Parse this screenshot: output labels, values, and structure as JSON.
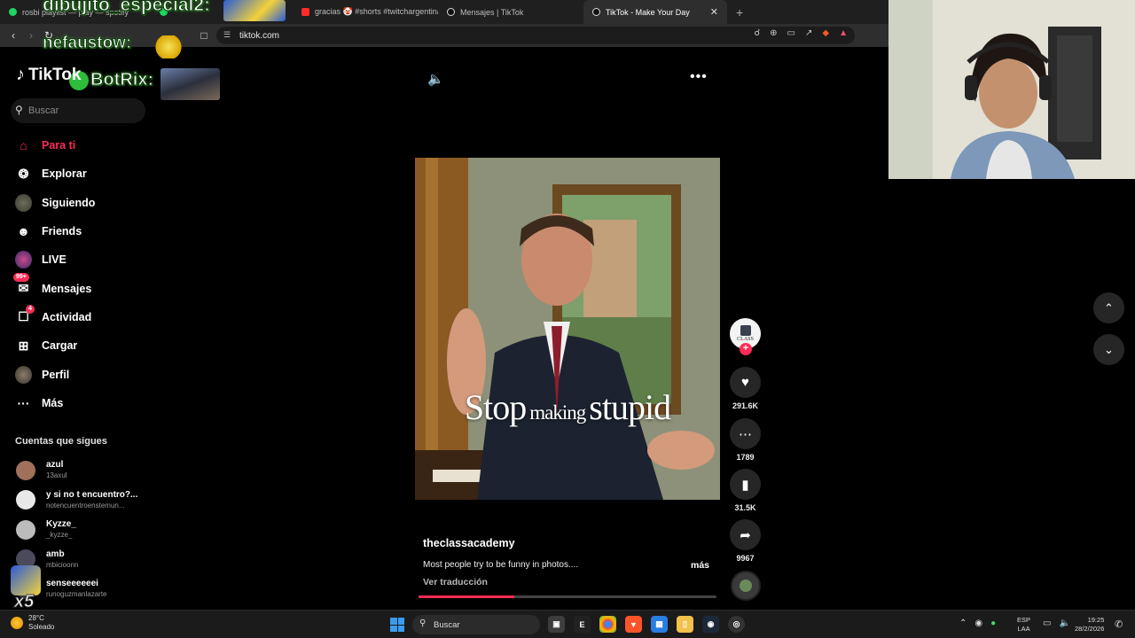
{
  "browser": {
    "tabs": [
      {
        "label": "rosbi playlist — play — spotify",
        "icon_color": "#1ed760"
      },
      {
        "label": "",
        "icon_color": "#1ed760"
      },
      {
        "label": "gracias 🤡 #shorts #twitchargentina",
        "icon_color": "#ff2b2b"
      },
      {
        "label": "Mensajes | TikTok",
        "icon_color": "#ffffff"
      },
      {
        "label": "TikTok - Make Your Day",
        "icon_color": "#ffffff"
      }
    ],
    "active_tab_close": "✕",
    "new_tab": "+",
    "url": "tiktok.com"
  },
  "overlays": {
    "line1": "dibujito_especial2:",
    "line2": "nefaustow:",
    "line3": "BotRix:",
    "x5": "x5"
  },
  "tiktok": {
    "logo": "TikTok",
    "search_placeholder": "Buscar",
    "menu": [
      {
        "label": "Para ti",
        "icon": "home-icon"
      },
      {
        "label": "Explorar",
        "icon": "compass-icon"
      },
      {
        "label": "Siguiendo",
        "icon": "avatar-icon"
      },
      {
        "label": "Friends",
        "icon": "people-icon"
      },
      {
        "label": "LIVE",
        "icon": "live-icon"
      },
      {
        "label": "Mensajes",
        "icon": "message-icon",
        "badge": "99+"
      },
      {
        "label": "Actividad",
        "icon": "activity-icon",
        "badge": "4"
      },
      {
        "label": "Cargar",
        "icon": "upload-icon"
      },
      {
        "label": "Perfil",
        "icon": "profile-icon"
      },
      {
        "label": "Más",
        "icon": "more-icon"
      }
    ],
    "following_title": "Cuentas que sigues",
    "following": [
      {
        "name": "azul",
        "handle": "13axul",
        "color": "#a0705a"
      },
      {
        "name": "y si no t encuentro?...",
        "handle": "notencuentroenstemun...",
        "color": "#e8e8e8"
      },
      {
        "name": "Kyzze_",
        "handle": "_kyzze_",
        "color": "#bcbcbc"
      },
      {
        "name": "amb",
        "handle": "mbicioonn",
        "color": "#4a4a5a"
      },
      {
        "name": "senseeeeeei",
        "handle": "runoguzmanlazarte",
        "color": "#3a3a3a"
      }
    ],
    "video": {
      "overlay_big1": "Stop",
      "overlay_small": "making",
      "overlay_big2": "stupid",
      "username": "theclassacademy",
      "description": "Most people try to be funny in photos....",
      "more": "más",
      "translate": "Ver traducción",
      "progress": 0.32
    },
    "actions": {
      "account_badge": "CLASS",
      "likes": "291.6K",
      "comments": "1789",
      "saves": "31.5K",
      "shares": "9967"
    }
  },
  "taskbar": {
    "temp": "28°C",
    "weather": "Soleado",
    "search": "Buscar",
    "lang1": "ESP",
    "lang2": "LAA",
    "time": "19:25",
    "date": "28/2/2026"
  }
}
